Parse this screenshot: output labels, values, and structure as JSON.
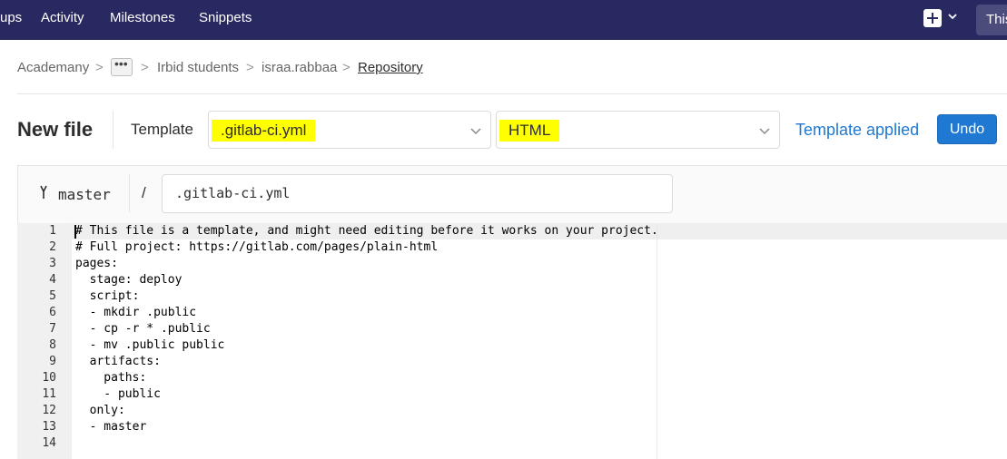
{
  "nav": {
    "items": [
      "ups",
      "Activity",
      "Milestones",
      "Snippets"
    ],
    "search_text": "This"
  },
  "breadcrumb": {
    "items": [
      "Academany",
      "•••",
      "Irbid students",
      "israa.rabbaa",
      "Repository"
    ],
    "separator": ">"
  },
  "header": {
    "title": "New file",
    "template_label": "Template",
    "template_type_value": ".gitlab-ci.yml",
    "template_value": "HTML",
    "applied_text": "Template applied",
    "undo_label": "Undo"
  },
  "editor": {
    "branch": "master",
    "slash": "/",
    "file_name": ".gitlab-ci.yml",
    "lines": [
      "# This file is a template, and might need editing before it works on your project.",
      "# Full project: https://gitlab.com/pages/plain-html",
      "pages:",
      "  stage: deploy",
      "  script:",
      "  - mkdir .public",
      "  - cp -r * .public",
      "  - mv .public public",
      "  artifacts:",
      "    paths:",
      "    - public",
      "  only:",
      "  - master",
      ""
    ],
    "line_numbers": [
      "1",
      "2",
      "3",
      "4",
      "5",
      "6",
      "7",
      "8",
      "9",
      "10",
      "11",
      "12",
      "13",
      "14"
    ]
  },
  "colors": {
    "navbar": "#292961",
    "highlight": "#ffff00",
    "primary": "#1f78d1"
  },
  "icons": [
    "plus-square-icon",
    "chevron-down-icon",
    "branch-icon"
  ]
}
